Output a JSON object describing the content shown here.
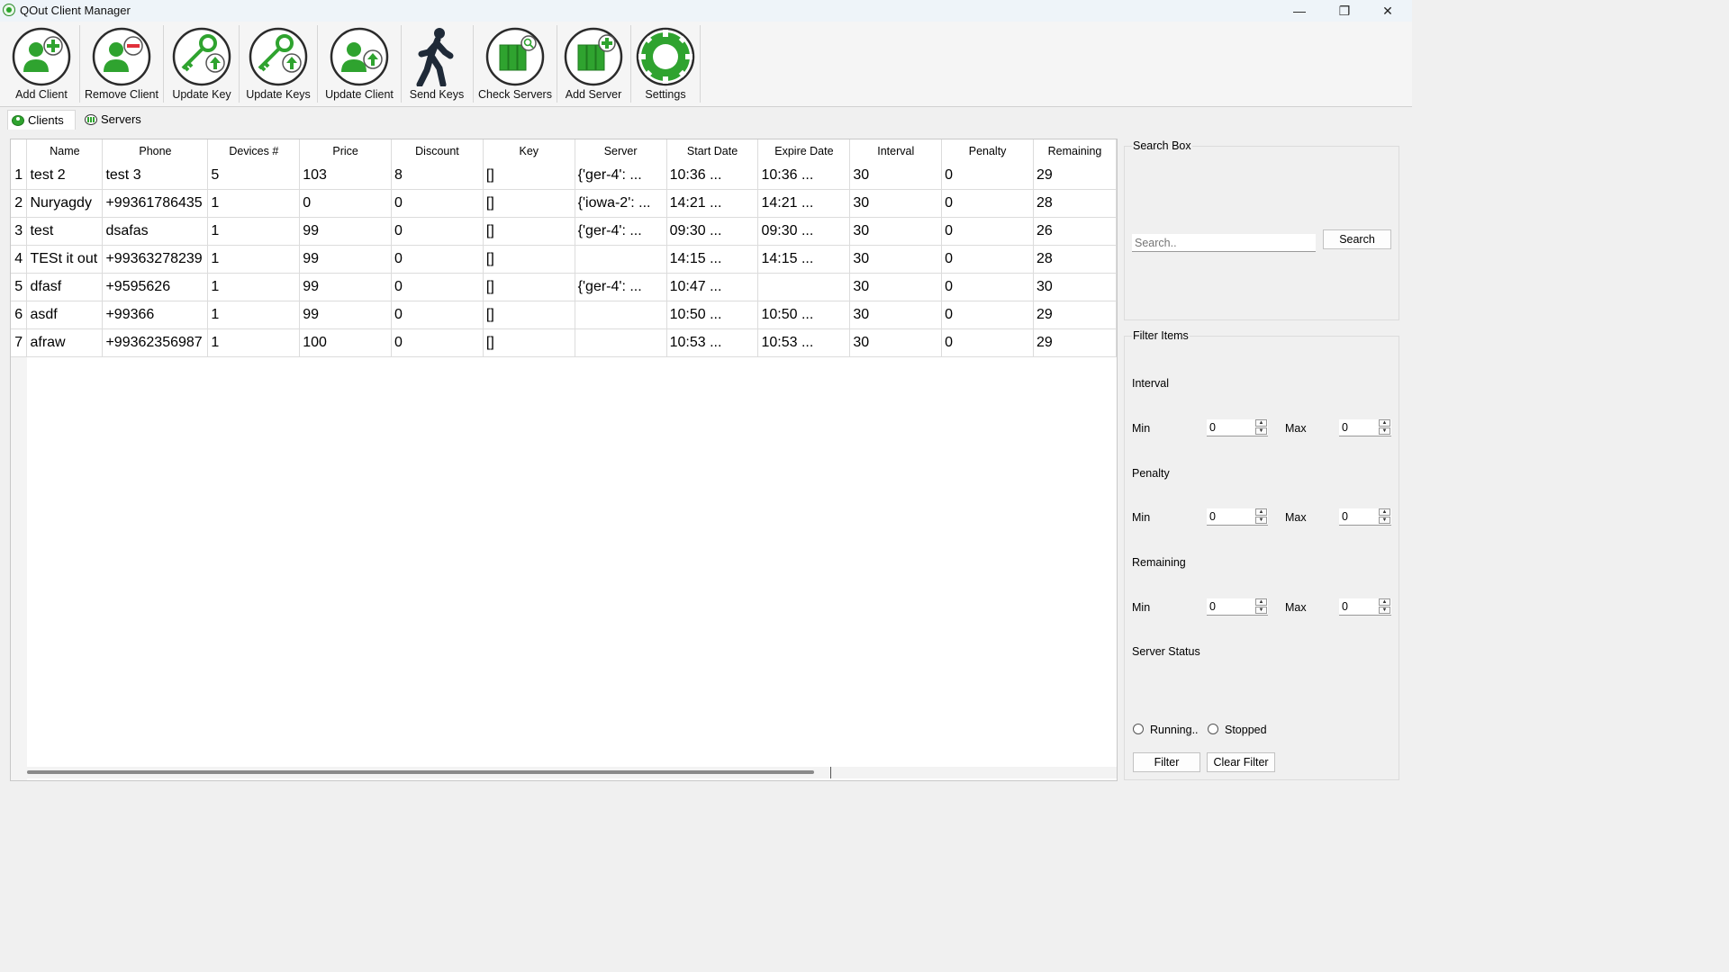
{
  "window": {
    "title": "QOut Client Manager",
    "controls": {
      "minimize": "—",
      "maximize": "❐",
      "close": "✕"
    }
  },
  "toolbar": {
    "buttons": [
      {
        "label": "Add Client",
        "icon": "add-client-icon"
      },
      {
        "label": "Remove Client",
        "icon": "remove-client-icon"
      },
      {
        "label": "Update Key",
        "icon": "update-key-icon"
      },
      {
        "label": "Update Keys",
        "icon": "update-keys-icon"
      },
      {
        "label": "Update Client",
        "icon": "update-client-icon"
      },
      {
        "label": "Send Keys",
        "icon": "walking-person-icon"
      },
      {
        "label": "Check Servers",
        "icon": "check-servers-icon"
      },
      {
        "label": "Add Server",
        "icon": "add-server-icon"
      },
      {
        "label": "Settings",
        "icon": "settings-gear-icon"
      }
    ]
  },
  "tabs": [
    {
      "label": "Clients",
      "icon": "clients-tab-icon",
      "active": true
    },
    {
      "label": "Servers",
      "icon": "servers-tab-icon",
      "active": false
    }
  ],
  "table": {
    "columns": [
      "Name",
      "Phone",
      "Devices #",
      "Price",
      "Discount",
      "Key",
      "Server",
      "Start Date",
      "Expire Date",
      "Interval",
      "Penalty",
      "Remaining"
    ],
    "rows": [
      {
        "num": "1",
        "cells": [
          "test 2",
          "test 3",
          "5",
          "103",
          "8",
          "[]",
          "{'ger-4': ...",
          "10:36 ...",
          "10:36 ...",
          "30",
          "0",
          "29"
        ]
      },
      {
        "num": "2",
        "cells": [
          "Nuryagdy",
          "+99361786435",
          "1",
          "0",
          "0",
          "[]",
          "{'iowa-2': ...",
          "14:21 ...",
          "14:21 ...",
          "30",
          "0",
          "28"
        ]
      },
      {
        "num": "3",
        "cells": [
          "test",
          "dsafas",
          "1",
          "99",
          "0",
          "[]",
          "{'ger-4': ...",
          "09:30 ...",
          "09:30 ...",
          "30",
          "0",
          "26"
        ]
      },
      {
        "num": "4",
        "cells": [
          "TESt it out",
          "+99363278239",
          "1",
          "99",
          "0",
          "[]",
          "",
          "14:15 ...",
          "14:15 ...",
          "30",
          "0",
          "28"
        ]
      },
      {
        "num": "5",
        "cells": [
          "dfasf",
          "+9595626",
          "1",
          "99",
          "0",
          "[]",
          "{'ger-4': ...",
          "10:47 ...",
          "",
          "30",
          "0",
          "30"
        ]
      },
      {
        "num": "6",
        "cells": [
          "asdf",
          "+99366",
          "1",
          "99",
          "0",
          "[]",
          "",
          "10:50 ...",
          "10:50 ...",
          "30",
          "0",
          "29"
        ]
      },
      {
        "num": "7",
        "cells": [
          "afraw",
          "+99362356987",
          "1",
          "100",
          "0",
          "[]",
          "",
          "10:53 ...",
          "10:53 ...",
          "30",
          "0",
          "29"
        ]
      }
    ]
  },
  "search_box": {
    "title": "Search Box",
    "placeholder": "Search..",
    "button": "Search"
  },
  "filter": {
    "title": "Filter Items",
    "interval_label": "Interval",
    "penalty_label": "Penalty",
    "remaining_label": "Remaining",
    "min_label": "Min",
    "max_label": "Max",
    "interval_min": "0",
    "interval_max": "0",
    "penalty_min": "0",
    "penalty_max": "0",
    "remaining_min": "0",
    "remaining_max": "0",
    "server_status_label": "Server Status",
    "running_label": "Running..",
    "stopped_label": "Stopped",
    "filter_button": "Filter",
    "clear_button": "Clear Filter"
  },
  "colors": {
    "accent_green": "#2fa32f",
    "dark_green": "#1f7a1f",
    "icon_outline": "#2b2b2b"
  }
}
